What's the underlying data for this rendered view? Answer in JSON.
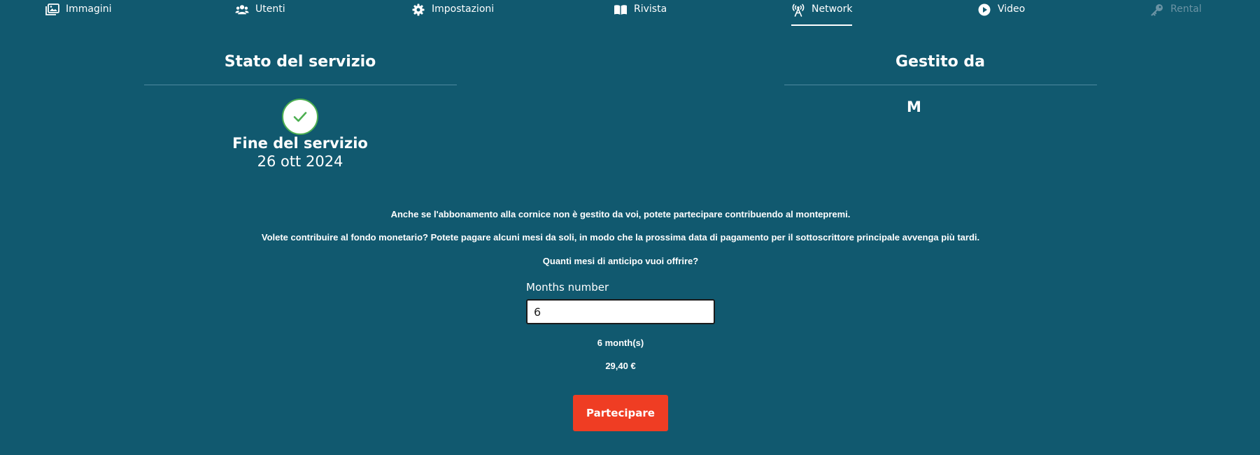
{
  "nav": {
    "items": [
      {
        "label": "Immagini",
        "icon": "images-icon"
      },
      {
        "label": "Utenti",
        "icon": "users-icon"
      },
      {
        "label": "Impostazioni",
        "icon": "gear-icon"
      },
      {
        "label": "Rivista",
        "icon": "open-book-icon"
      },
      {
        "label": "Network",
        "icon": "broadcast-tower-icon",
        "active": true
      },
      {
        "label": "Video",
        "icon": "play-circle-icon"
      },
      {
        "label": "Rental",
        "icon": "key-icon",
        "disabled": true
      }
    ]
  },
  "status_section": {
    "title": "Stato del servizio",
    "icon": "check-circle-icon",
    "end_label": "Fine del servizio",
    "end_date": "26 ott 2024"
  },
  "managed_section": {
    "title": "Gestito da",
    "initial": "M"
  },
  "info": {
    "line1": "Anche se l'abbonamento alla cornice non è gestito da voi, potete partecipare contribuendo al montepremi.",
    "line2": "Volete contribuire al fondo monetario? Potete pagare alcuni mesi da soli, in modo che la prossima data di pagamento per il sottoscrittore principale avvenga più tardi.",
    "question": "Quanti mesi di anticipo vuoi offrire?"
  },
  "form": {
    "months_label": "Months number",
    "months_value": "6",
    "months_summary": "6 month(s)",
    "price": "29,40 €",
    "submit_label": "Partecipare"
  },
  "colors": {
    "background": "#11596f",
    "accent": "#ef3d23",
    "success": "#4caf50",
    "disabled_text": "#6b93a4"
  }
}
